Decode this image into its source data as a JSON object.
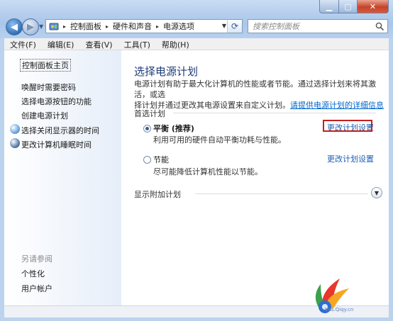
{
  "address_bar": {
    "crumbs": [
      "控制面板",
      "硬件和声音",
      "电源选项"
    ]
  },
  "search": {
    "placeholder": "搜索控制面板"
  },
  "menu": [
    "文件(F)",
    "编辑(E)",
    "查看(V)",
    "工具(T)",
    "帮助(H)"
  ],
  "sidebar": {
    "home": "控制面板主页",
    "links": [
      "唤醒时需要密码",
      "选择电源按钮的功能",
      "创建电源计划",
      "选择关闭显示器的时间",
      "更改计算机睡眠时间"
    ],
    "see_also_label": "另请参阅",
    "see_also": [
      "个性化",
      "用户帐户"
    ]
  },
  "main": {
    "title": "选择电源计划",
    "desc_line1": "电源计划有助于最大化计算机的性能或者节能。通过选择计划来将其激活，或选",
    "desc_line2_prefix": "择计划并通过更改其电源设置来自定义计划。",
    "desc_link": "请提供电源计划的详细信息",
    "preferred_label": "首选计划",
    "plans": [
      {
        "name": "平衡 (推荐)",
        "desc": "利用可用的硬件自动平衡功耗与性能。",
        "link": "更改计划设置",
        "selected": true
      },
      {
        "name": "节能",
        "desc": "尽可能降低计算机性能以节能。",
        "link": "更改计划设置",
        "selected": false
      }
    ],
    "more_label": "显示附加计划"
  },
  "watermark": {
    "text": "bbs.Qiqy.cn"
  }
}
